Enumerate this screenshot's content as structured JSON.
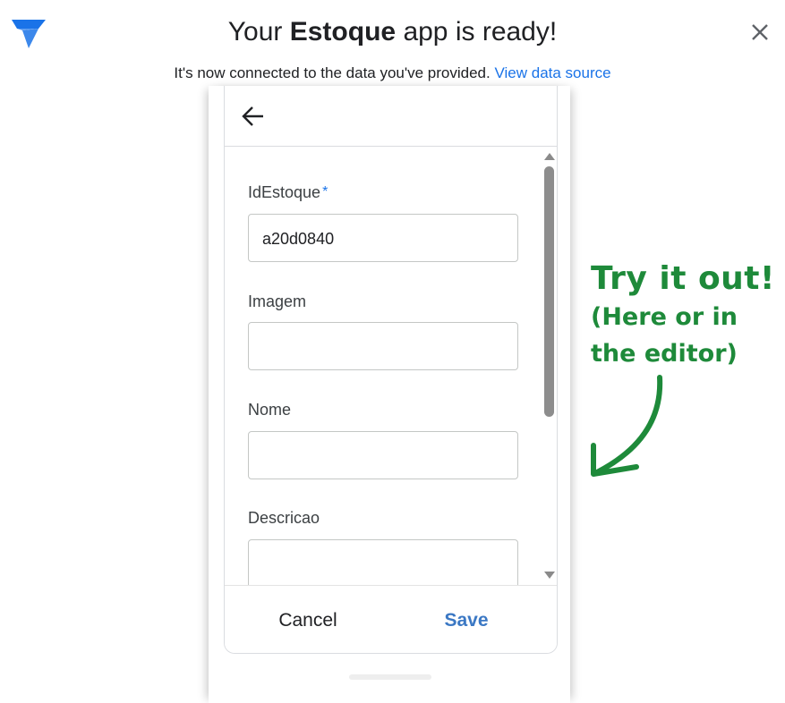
{
  "header": {
    "title_prefix": "Your",
    "app_name": "Estoque",
    "title_suffix": "app is ready!",
    "subtitle": "It's now connected to the data you've provided.",
    "view_source_link": "View data source",
    "logo_icon": "appsheet-logo-icon",
    "close_icon": "close-icon",
    "accent_color": "#1a73e8"
  },
  "app": {
    "back_icon": "arrow-left-icon",
    "fields": [
      {
        "label": "IdEstoque",
        "required_marker": "*",
        "value": "a20d0840"
      },
      {
        "label": "Imagem",
        "value": ""
      },
      {
        "label": "Nome",
        "value": ""
      },
      {
        "label": "Descricao",
        "value": ""
      }
    ],
    "cancel_label": "Cancel",
    "save_label": "Save",
    "save_color": "#3b78c4"
  },
  "callout": {
    "line1": "Try it out!",
    "line2": "(Here or in",
    "line3": "the editor)",
    "color": "#1e8a3a"
  }
}
